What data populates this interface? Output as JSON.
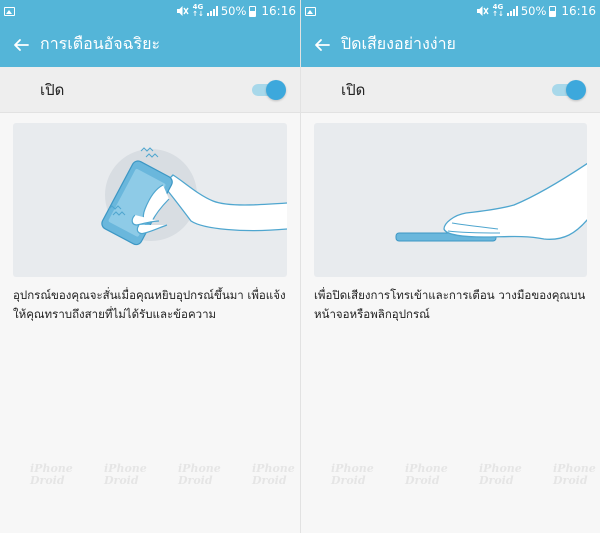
{
  "status_bar": {
    "battery_text": "50%",
    "time": "16:16",
    "network_top": "4G",
    "network_bottom": "↑↓"
  },
  "screens": [
    {
      "title": "การเตือนอัจฉริยะ",
      "toggle_label": "เปิด",
      "toggle_on": true,
      "description": "อุปกรณ์ของคุณจะสั่นเมื่อคุณหยิบอุปกรณ์ขึ้นมา เพื่อแจ้งให้คุณทราบถึงสายที่ไม่ได้รับและข้อความ"
    },
    {
      "title": "ปิดเสียงอย่างง่าย",
      "toggle_label": "เปิด",
      "toggle_on": true,
      "description": "เพื่อปิดเสียงการโทรเข้าและการเตือน วางมือของคุณบนหน้าจอหรือพลิกอุปกรณ์"
    }
  ],
  "watermark": {
    "line1": "iPhone",
    "line2": "Droid"
  },
  "colors": {
    "accent": "#54b5d8",
    "switch_thumb": "#3da8dc",
    "switch_track": "#a8d8ea",
    "background": "#f7f7f7",
    "illustration_bg": "#e8ebee"
  },
  "icons": {
    "back": "arrow-left-icon",
    "status_image": "image-notification-icon",
    "mute": "mute-icon",
    "signal": "signal-icon",
    "battery": "battery-icon"
  }
}
